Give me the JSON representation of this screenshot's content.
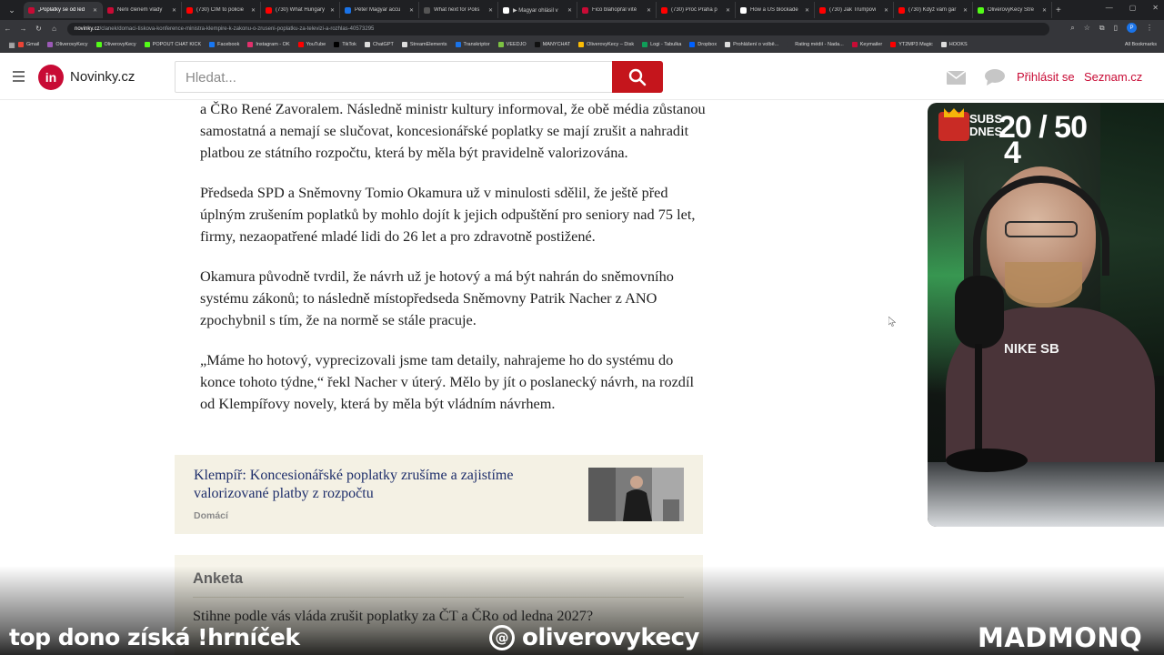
{
  "browser": {
    "tabs": [
      {
        "title": "„Poplatky se od led",
        "color": "#c80b35",
        "active": true
      },
      {
        "title": "Není členem vlády",
        "color": "#c80b35"
      },
      {
        "title": "(730) ČÍM to policie",
        "color": "#ff0000"
      },
      {
        "title": "(730) What Hungary",
        "color": "#ff0000"
      },
      {
        "title": "Péter Magyar accu",
        "color": "#1a73e8"
      },
      {
        "title": "What next for Polis",
        "color": "#555555"
      },
      {
        "title": "▶ Magyar ohlásil v",
        "color": "#ffffff"
      },
      {
        "title": "Fico blahopřál vítě",
        "color": "#c80b35"
      },
      {
        "title": "(730) Proč Praha p",
        "color": "#ff0000"
      },
      {
        "title": "How a US blockade",
        "color": "#ffffff"
      },
      {
        "title": "(730) Jak Trumpovi",
        "color": "#ff0000"
      },
      {
        "title": "(730) Když vám gar",
        "color": "#ff0000"
      },
      {
        "title": "OliverovyKecy Stre",
        "color": "#53fc18"
      }
    ],
    "url_host": "novinky.cz",
    "url_path": "/clanek/domaci-tiskova-konference-ministra-klempire-k-zakonu-o-zruseni-poplatku-za-televizi-a-rozhlas-40573295",
    "bookmarks": [
      {
        "label": "Gmail",
        "color": "#ea4335"
      },
      {
        "label": "OliverovyKecy",
        "color": "#9b59b6"
      },
      {
        "label": "OliverovyKecy",
        "color": "#53fc18"
      },
      {
        "label": "POPOUT CHAT KICK",
        "color": "#53fc18"
      },
      {
        "label": "Facebook",
        "color": "#1877f2"
      },
      {
        "label": "Instagram - OK",
        "color": "#e1306c"
      },
      {
        "label": "YouTube",
        "color": "#ff0000"
      },
      {
        "label": "TikTok",
        "color": "#000000"
      },
      {
        "label": "ChatGPT",
        "color": "#dddddd"
      },
      {
        "label": "StreamElements",
        "color": "#dddddd"
      },
      {
        "label": "Transkriptor",
        "color": "#1a73e8"
      },
      {
        "label": "VEEDJO",
        "color": "#7cc242"
      },
      {
        "label": "MANYCHAT",
        "color": "#111111"
      },
      {
        "label": "OliverovyKecy – Disk",
        "color": "#fbbc04"
      },
      {
        "label": "Logi - Tabulka",
        "color": "#0f9d58"
      },
      {
        "label": "Dropbox",
        "color": "#0061ff"
      },
      {
        "label": "Prohlášení o volbě...",
        "color": "#dddddd"
      },
      {
        "label": "Rating médií - Nada...",
        "color": "#35363a"
      },
      {
        "label": "Keymailer",
        "color": "#c80b35"
      },
      {
        "label": "YT2MP3 Magic",
        "color": "#ff0000"
      },
      {
        "label": "HOOKS",
        "color": "#dddddd"
      }
    ],
    "all_bookmarks": "All Bookmarks",
    "profile_initial": "P"
  },
  "site": {
    "logo_badge": "in",
    "logo_text": "Novinky.cz",
    "search_placeholder": "Hledat...",
    "login": "Přihlásit se",
    "seznam": "Seznam.cz"
  },
  "article": {
    "paragraphs": [
      "a ČRo René Zavoralem. Následně ministr kultury informoval, že obě média zůstanou samostatná a nemají se slučovat, koncesionářské poplatky se mají zrušit a nahradit platbou ze státního rozpočtu, která by měla být pravidelně valorizována.",
      "Předseda SPD a Sněmovny Tomio Okamura už v minulosti sdělil, že ještě před úplným zrušením poplatků by mohlo dojít k jejich odpuštění pro seniory nad 75 let, firmy, nezaopatřené mladé lidi do 26 let a pro zdravotně postižené.",
      "Okamura původně tvrdil, že návrh už je hotový a má být nahrán do sněmovního systému zákonů; to následně místopředseda Sněmovny Patrik Nacher z ANO zpochybnil s tím, že na normě se stále pracuje.",
      "„Máme ho hotový, vyprecizovali jsme tam detaily, nahrajeme ho do systému do konce tohoto týdne,“ řekl Nacher v úterý. Mělo by jít o poslanecký návrh, na rozdíl od Klempířovy novely, která by měla být vládním návrhem."
    ],
    "related": {
      "title": "Klempíř: Koncesionářské poplatky zrušíme a zajistíme valorizované platby z rozpočtu",
      "category": "Domácí"
    },
    "poll": {
      "heading": "Anketa",
      "question": "Stihne podle vás vláda zrušit poplatky za ČT a ČRo od ledna 2027?"
    }
  },
  "stream": {
    "subs_label_line1": "SUBS",
    "subs_label_line2": "DNES",
    "subs_count": "20 / 50",
    "subs_under": "4",
    "shirt_text": "NIKE SB",
    "overlay_left": "top dono získá !hrníček",
    "overlay_center": "oliverovykecy",
    "overlay_right": "MADMONQ"
  }
}
